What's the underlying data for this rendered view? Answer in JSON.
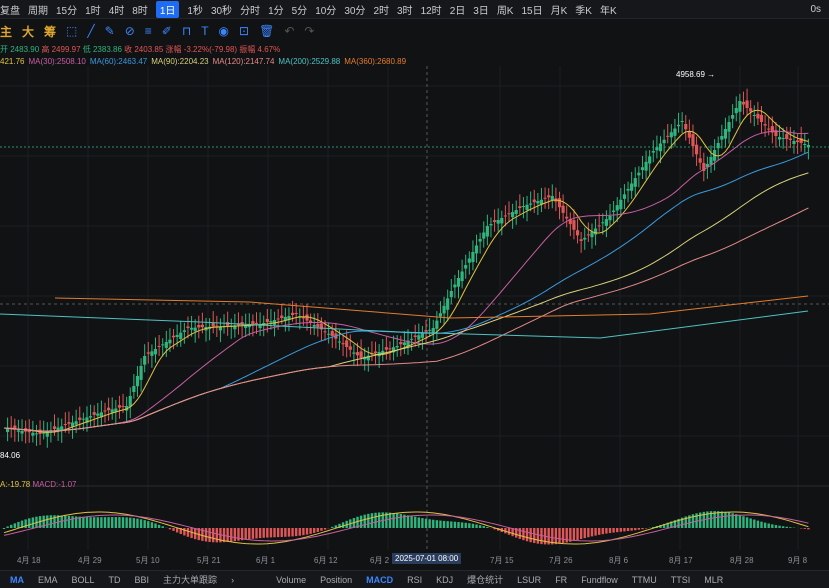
{
  "toolbar": {
    "items": [
      "复盘",
      "周期",
      "15分",
      "1时",
      "4时",
      "8时",
      "1日",
      "1秒",
      "30秒",
      "分时",
      "1分",
      "5分",
      "10分",
      "30分",
      "2时",
      "3时",
      "12时",
      "2日",
      "3日",
      "周K",
      "15日",
      "月K",
      "季K",
      "年K"
    ],
    "active": "1日",
    "right_label": "0s"
  },
  "indicator_buttons": [
    "主",
    "大",
    "筹"
  ],
  "info_line": {
    "open": "开 2483.90",
    "high": "高 2499.97",
    "low": "低 2383.86",
    "close": "收 2403.85",
    "change": "涨幅 -3.22%(-79.98)",
    "amplitude": "振幅 4.67%"
  },
  "ma_line": [
    {
      "label": "421.76",
      "color": "#e0c341"
    },
    {
      "label": "MA(30):2508.10",
      "color": "#c75fa3"
    },
    {
      "label": "MA(60):2463.47",
      "color": "#3b9adf"
    },
    {
      "label": "MA(90):2204.23",
      "color": "#d8d07a"
    },
    {
      "label": "MA(120):2147.74",
      "color": "#e58a8a"
    },
    {
      "label": "MA(200):2529.88",
      "color": "#4fc3c3"
    },
    {
      "label": "MA(360):2680.89",
      "color": "#e37d2c"
    }
  ],
  "annotations": {
    "peak": "4958.69 →",
    "low": "84.06"
  },
  "macd_label": {
    "dea": "A:-19.78",
    "macd": "MACD:-1.07"
  },
  "crosshair_date": "2025-07-01 08:00",
  "x_axis": [
    "4月 18",
    "4月 29",
    "5月 10",
    "5月 21",
    "6月 1",
    "6月 12",
    "6月 2",
    "7月 15",
    "7月 26",
    "8月 6",
    "8月 17",
    "8月 28",
    "9月 8"
  ],
  "bottom_tabs": [
    "MA",
    "EMA",
    "BOLL",
    "TD",
    "BBI",
    "主力大单跟踪",
    "›",
    "Volume",
    "Position",
    "MACD",
    "RSI",
    "KDJ",
    "爆仓统计",
    "LSUR",
    "FR",
    "Fundflow",
    "TTMU",
    "TTSI",
    "MLR"
  ],
  "active_main_tab": "MA",
  "active_sub_tab": "MACD",
  "colors": {
    "up": "#2fb57e",
    "down": "#e15656",
    "accent": "#1e6cf2"
  }
}
